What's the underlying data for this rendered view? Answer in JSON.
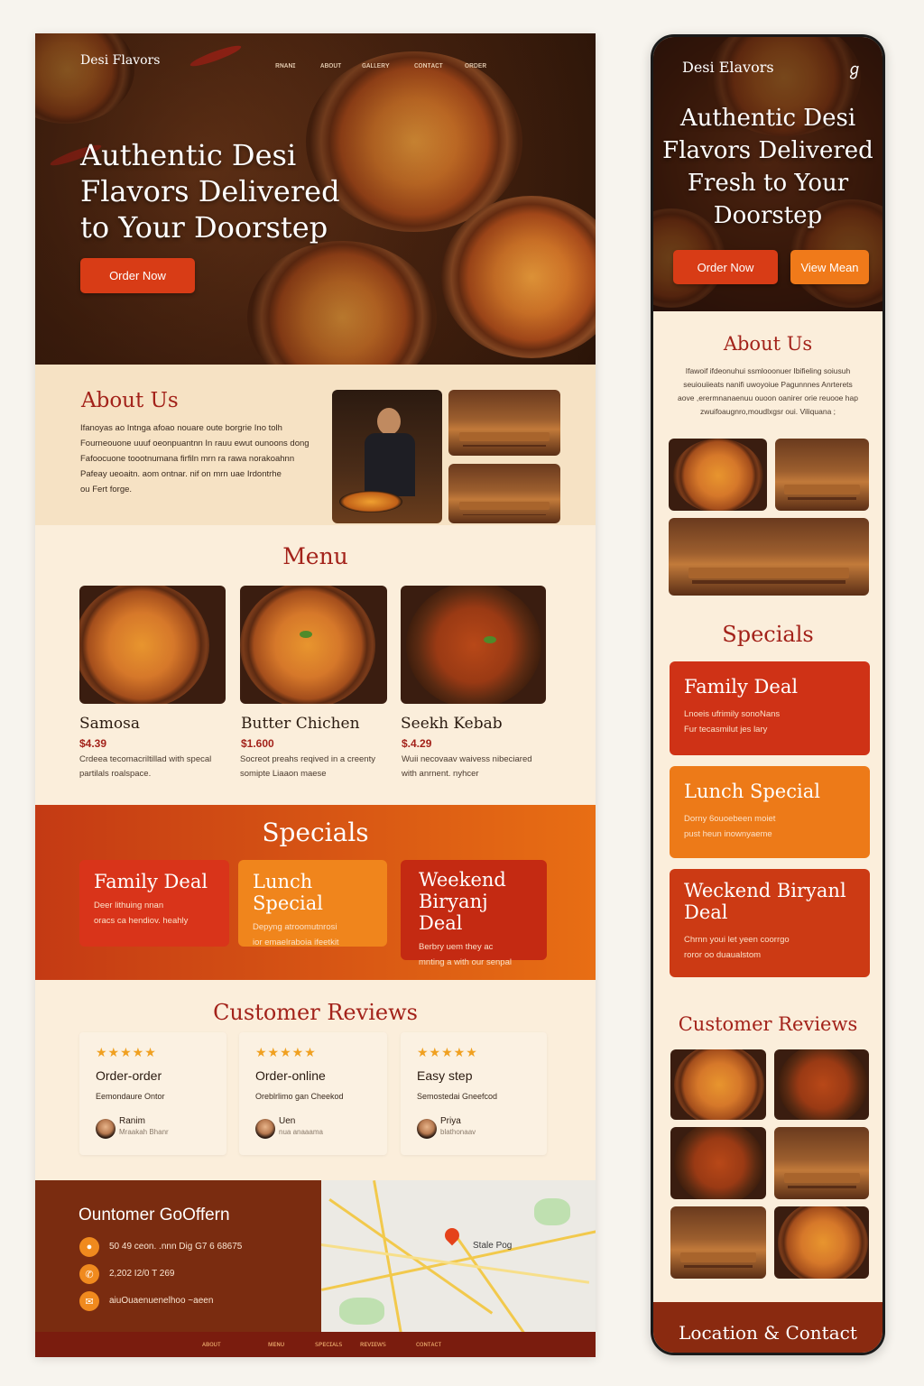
{
  "desktop": {
    "nav": {
      "logo": "Desi Flavors",
      "items": [
        "ʀɴᴀɴɪ",
        "ᴀʙᴏᴜᴛ",
        "ɢᴀʟʟᴇʀʏ",
        "ᴄᴏɴᴛᴀᴄᴛ",
        "ᴏʀᴅᴇʀ"
      ]
    },
    "hero": {
      "title_line1": "Authentic Desi",
      "title_line2": "Flavors Delivered",
      "title_line3": "to Your Doorstep",
      "cta": "Order Now"
    },
    "about": {
      "title": "About Us",
      "lines": [
        "Ifanoyas ao Intnga afoao nouare oute borgrie Ino tolh",
        "Fourneouone uuuf oeonpuantnn In rauu ewut ounoons dong",
        "Fafoocuone toootnumana firfiln mrn ra rawa norakoahnn",
        "Pafeay ueoaitn. aom ontnar. nif on mrn uae Irdontrhe",
        "ou Fert forge."
      ]
    },
    "menu": {
      "title": "Menu",
      "items": [
        {
          "name": "Samosa",
          "price": "$4.39",
          "desc1": "Crdeea tecomacriltillad with specal",
          "desc2": "partilals roalspace."
        },
        {
          "name": "Butter Chichen",
          "price": "$1.600",
          "desc1": "Socreot preahs reqived in a creenty",
          "desc2": "somipte Liaaon maese"
        },
        {
          "name": "Seekh Kebab",
          "price": "$.4.29",
          "desc1": "Wuii necovaav waivess nibeciared",
          "desc2": "with anrnent. nyhcer"
        }
      ]
    },
    "specials": {
      "title": "Specials",
      "cards": [
        {
          "title": "Family Deal",
          "d1": "Deer lithuing nnan",
          "d2": "oracs ca hendiov. heahly",
          "color": "#d9341a"
        },
        {
          "title": "Lunch Special",
          "d1": "Depyng atroomutnrosi",
          "d2": "ior emaelraboia ifeetkit",
          "color": "#f0851c"
        },
        {
          "title": "Weekend Biryanj Deal",
          "d1": "Berbry uem they ac",
          "d2": "mnting a with our senpal",
          "color": "#c42a12"
        }
      ]
    },
    "reviews": {
      "title": "Customer Reviews",
      "cards": [
        {
          "stars": "★★★★★",
          "title": "Order-order",
          "text": "Eemondaure   Ontor",
          "name": "Ranim",
          "sub": "Mraakah Bhanr"
        },
        {
          "stars": "★★★★★",
          "title": "Order-online",
          "text": "Oreblrlimo gan   Cheekod",
          "name": "Uen",
          "sub": "nua anaaama"
        },
        {
          "stars": "★★★★★",
          "title": "Easy step",
          "text": "Semostedai   Gneefcod",
          "name": "Priya",
          "sub": "blathonaav"
        }
      ]
    },
    "contact": {
      "title": "Ountomer GoOffern",
      "lines": [
        "50  49 ceon.   .nnn Dig   G7 6 68675",
        "2,202 I2/0 T 269",
        "aiuOuaenuenelhoo ~aeen"
      ],
      "map_label": "Stale Pog"
    },
    "footer": {
      "items": [
        "ᴀʙᴏᴜᴛ",
        "ᴍᴇɴᴜ",
        "ꜱᴘᴇᴄɪᴀʟꜱ",
        "ʀᴇᴠɪᴇᴡꜱ",
        "ᴄᴏɴᴛᴀᴄᴛ"
      ]
    }
  },
  "mobile": {
    "nav": {
      "logo": "Desi Elavors",
      "menu_icon": "ℊ"
    },
    "hero": {
      "title_line1": "Authentic Desi",
      "title_line2": "Flavors Delivered",
      "title_line3": "Fresh to Your",
      "title_line4": "Doorstep",
      "cta1": "Order Now",
      "cta2": "View Mean"
    },
    "about": {
      "title": "About Us",
      "lines": [
        "Ifawoif ifdeonuhui ssmlooonuer Ibifieling soiusuh",
        "seuiouiieats nanifi uwoyoiue Pagunnnes Anrterets",
        "aove ,erermnanaenuu ouoon oanirer orie reuooe hap",
        "zwuifoaugnro,moudlxgsr oui. Viliquana ;"
      ]
    },
    "specials": {
      "title": "Specials",
      "cards": [
        {
          "title": "Family Deal",
          "d1": "Lnoeis ufrimily sonoNans",
          "d2": "Fur tecasmilut jes lary",
          "color": "#cf3216"
        },
        {
          "title": "Lunch Special",
          "d1": "Dorny 6ouoebeen moiet",
          "d2": "pust heun inownyaeme",
          "color": "#ed7a18"
        },
        {
          "title": "Weckend Biryanl Deal",
          "d1": "Chrnn youi let yeen coorrgo",
          "d2": "roror oo duaualstom",
          "color": "#cc3a14"
        }
      ]
    },
    "reviews": {
      "title": "Customer Reviews"
    },
    "contact": {
      "title": "Location & Contact"
    }
  },
  "colors": {
    "brand_red": "#a3221a",
    "accent_orange": "#f0851c",
    "deep_brown": "#7a2c10"
  }
}
